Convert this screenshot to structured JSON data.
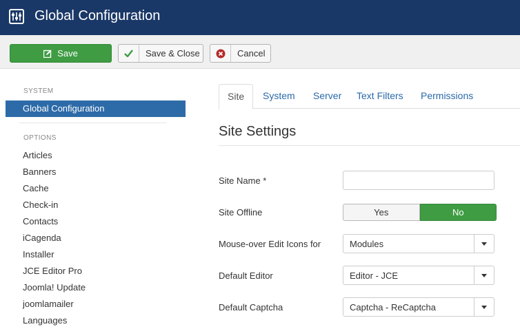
{
  "header": {
    "title": "Global Configuration",
    "icon": "sliders-icon"
  },
  "toolbar": {
    "save_label": "Save",
    "save_close_label": "Save & Close",
    "cancel_label": "Cancel",
    "colors": {
      "save_bg": "#3f9c43",
      "check": "#3f9c43",
      "cancel": "#b52a2a"
    }
  },
  "sidebar": {
    "system_header": "SYSTEM",
    "active_item": "Global Configuration",
    "options_header": "OPTIONS",
    "items": [
      "Articles",
      "Banners",
      "Cache",
      "Check-in",
      "Contacts",
      "iCagenda",
      "Installer",
      "JCE Editor Pro",
      "Joomla! Update",
      "joomlamailer",
      "Languages"
    ]
  },
  "tabs": [
    "Site",
    "System",
    "Server",
    "Text Filters",
    "Permissions"
  ],
  "main": {
    "section_title": "Site Settings",
    "site_name_label": "Site Name *",
    "site_name_value": "",
    "site_offline_label": "Site Offline",
    "offline_yes": "Yes",
    "offline_no": "No",
    "edit_icons_label": "Mouse-over Edit Icons for",
    "edit_icons_value": "Modules",
    "default_editor_label": "Default Editor",
    "default_editor_value": "Editor - JCE",
    "default_captcha_label": "Default Captcha",
    "default_captcha_value": "Captcha - ReCaptcha"
  },
  "colors": {
    "header_bg": "#1a3867",
    "active_nav": "#2d6ba8",
    "link": "#2a69a8"
  }
}
